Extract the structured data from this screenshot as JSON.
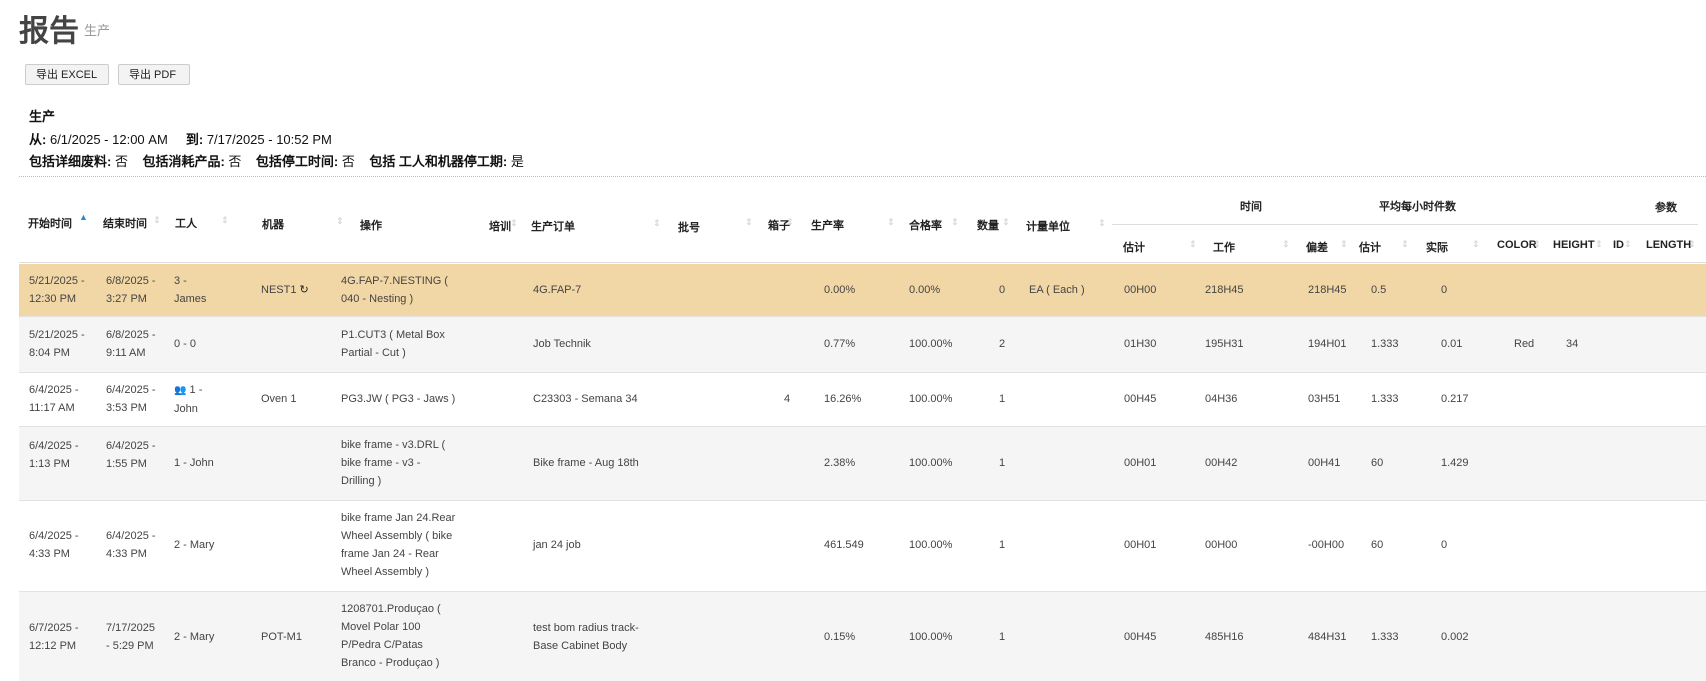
{
  "page": {
    "title": "报告",
    "subtitle": "生产"
  },
  "toolbar": {
    "excel_label": "导出 EXCEL",
    "pdf_label": "导出 PDF"
  },
  "report": {
    "section": "生产",
    "from_label": "从:",
    "from_value": "6/1/2025 - 12:00 AM",
    "to_label": "到:",
    "to_value": "7/17/2025 - 10:52 PM",
    "flag1_label": "包括详细废料:",
    "flag1_value": "否",
    "flag2_label": "包括消耗产品:",
    "flag2_value": "否",
    "flag3_label": "包括停工时间:",
    "flag3_value": "否",
    "flag4_label": "包括 工人和机器停工期:",
    "flag4_value": "是"
  },
  "table": {
    "group_headers": {
      "time": "时间",
      "avg": "平均每小时件数",
      "params": "参数"
    },
    "headers": {
      "start": "开始时间",
      "end": "结束时间",
      "worker": "工人",
      "machine": "机器",
      "operation": "操作",
      "training": "培训",
      "order": "生产订单",
      "batch": "批号",
      "box": "箱子",
      "rate": "生产率",
      "quality": "合格率",
      "qty": "数量",
      "unit": "计量单位",
      "est": "估计",
      "work": "工作",
      "dev": "偏差",
      "avg_est": "估计",
      "avg_act": "实际",
      "color": "COLOR",
      "height": "HEIGHT",
      "id": "ID",
      "length": "LENGTH"
    },
    "rows": [
      {
        "start": "5/21/2025 - 12:30 PM",
        "end": "6/8/2025 - 3:27 PM",
        "worker": "3 - James",
        "machine": "NEST1",
        "operation": "4G.FAP-7.NESTING ( 040 - Nesting )",
        "order": "4G.FAP-7",
        "box": "",
        "rate": "0.00%",
        "quality": "0.00%",
        "qty": "0",
        "unit": "EA ( Each )",
        "est": "00H00",
        "work": "218H45",
        "dev": "218H45",
        "avg_est": "0.5",
        "avg_act": "0",
        "color": "",
        "height": ""
      },
      {
        "start": "5/21/2025 - 8:04 PM",
        "end": "6/8/2025 - 9:11 AM",
        "worker": "0 - 0",
        "machine": "",
        "operation": "P1.CUT3 ( Metal Box Partial - Cut )",
        "order": "Job Technik",
        "box": "",
        "rate": "0.77%",
        "quality": "100.00%",
        "qty": "2",
        "unit": "",
        "est": "01H30",
        "work": "195H31",
        "dev": "194H01",
        "avg_est": "1.333",
        "avg_act": "0.01",
        "color": "Red",
        "height": "34"
      },
      {
        "start": "6/4/2025 - 11:17 AM",
        "end": "6/4/2025 - 3:53 PM",
        "worker": "1 - John",
        "machine": "Oven 1",
        "operation": "PG3.JW ( PG3 - Jaws )",
        "order": "C23303 - Semana 34",
        "box": "4",
        "rate": "16.26%",
        "quality": "100.00%",
        "qty": "1",
        "unit": "",
        "est": "00H45",
        "work": "04H36",
        "dev": "03H51",
        "avg_est": "1.333",
        "avg_act": "0.217",
        "color": "",
        "height": ""
      },
      {
        "start": "6/4/2025 - 1:13 PM",
        "end": "6/4/2025 - 1:55 PM",
        "worker": "1 - John",
        "machine": "",
        "operation": "bike frame - v3.DRL ( bike frame - v3 - Drilling )",
        "order": "Bike frame - Aug 18th",
        "box": "",
        "rate": "2.38%",
        "quality": "100.00%",
        "qty": "1",
        "unit": "",
        "est": "00H01",
        "work": "00H42",
        "dev": "00H41",
        "avg_est": "60",
        "avg_act": "1.429",
        "color": "",
        "height": ""
      },
      {
        "start": "6/4/2025 - 4:33 PM",
        "end": "6/4/2025 - 4:33 PM",
        "worker": "2 - Mary",
        "machine": "",
        "operation": "bike frame Jan 24.Rear Wheel Assembly ( bike frame Jan 24 - Rear Wheel Assembly )",
        "order": "jan 24 job",
        "box": "",
        "rate": "461.549",
        "quality": "100.00%",
        "qty": "1",
        "unit": "",
        "est": "00H01",
        "work": "00H00",
        "dev": "-00H00",
        "avg_est": "60",
        "avg_act": "0",
        "color": "",
        "height": ""
      },
      {
        "start": "6/7/2025 - 12:12 PM",
        "end": "7/17/2025 - 5:29 PM",
        "worker": "2 - Mary",
        "machine": "POT-M1",
        "operation": "1208701.Produçao ( Movel Polar 100 P/Pedra C/Patas Branco - Produçao )",
        "order": "test bom radius track-Base Cabinet Body",
        "box": "",
        "rate": "0.15%",
        "quality": "100.00%",
        "qty": "1",
        "unit": "",
        "est": "00H45",
        "work": "485H16",
        "dev": "484H31",
        "avg_est": "1.333",
        "avg_act": "0.002",
        "color": "",
        "height": ""
      }
    ]
  }
}
